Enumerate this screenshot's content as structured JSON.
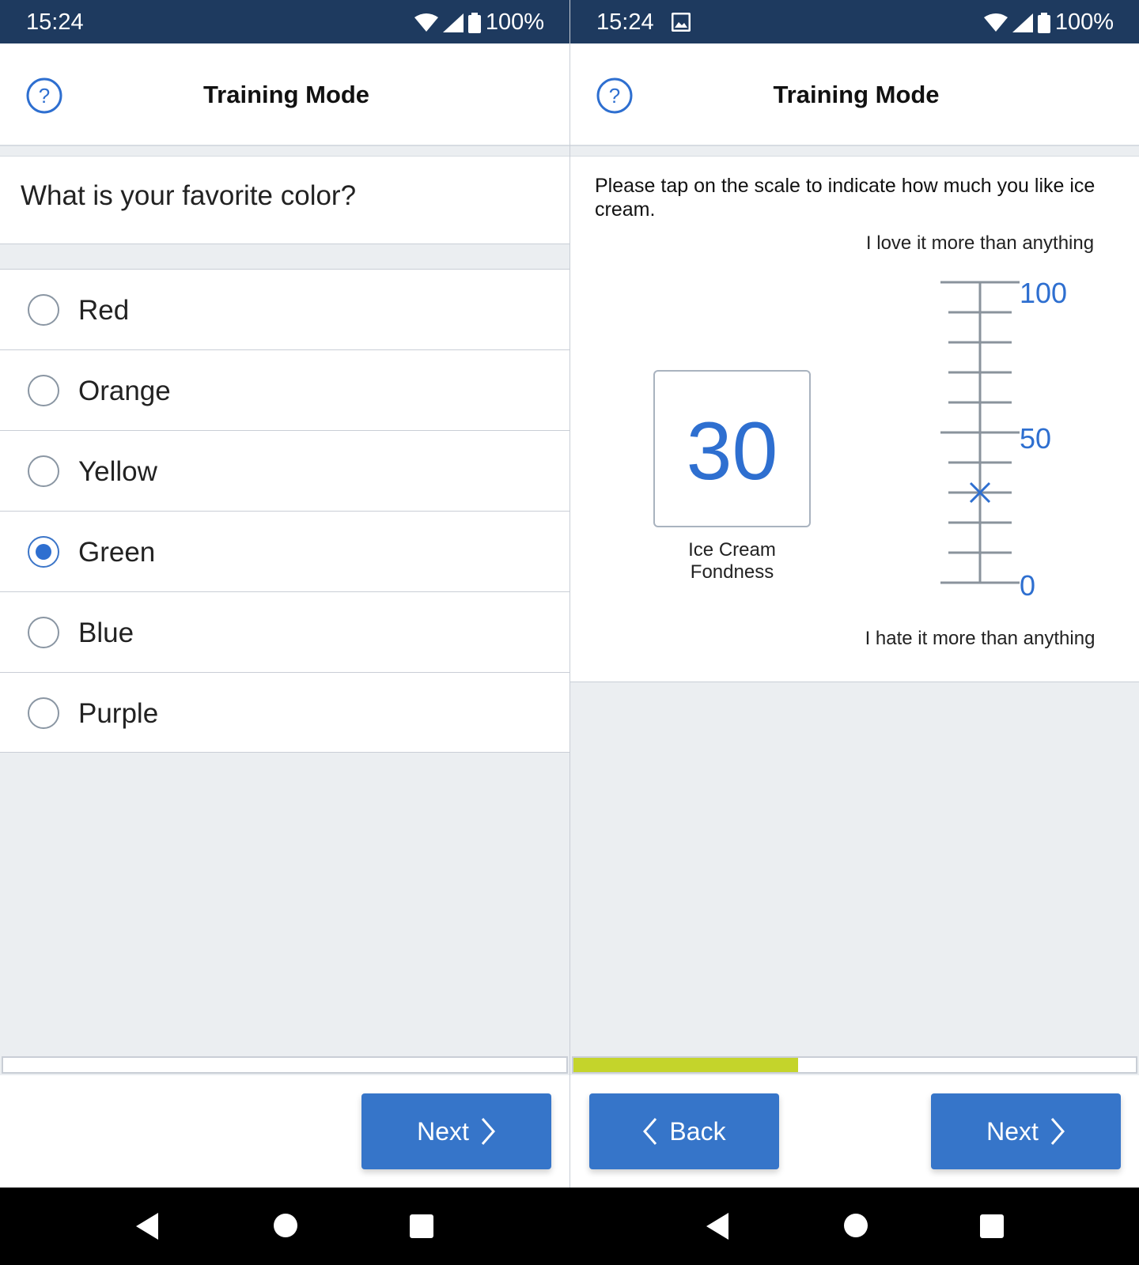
{
  "left_screen": {
    "status_bar": {
      "time": "15:24",
      "battery": "100%"
    },
    "app_bar": {
      "title": "Training Mode",
      "help_icon": "help-circle-icon"
    },
    "question": "What is your favorite color?",
    "options": [
      {
        "label": "Red",
        "selected": false
      },
      {
        "label": "Orange",
        "selected": false
      },
      {
        "label": "Yellow",
        "selected": false
      },
      {
        "label": "Green",
        "selected": true
      },
      {
        "label": "Blue",
        "selected": false
      },
      {
        "label": "Purple",
        "selected": false
      }
    ],
    "progress_fraction": 0,
    "next_label": "Next"
  },
  "right_screen": {
    "status_bar": {
      "time": "15:24",
      "battery": "100%"
    },
    "app_bar": {
      "title": "Training Mode",
      "help_icon": "help-circle-icon"
    },
    "instructions": "Please tap on the scale to indicate how much you like ice cream.",
    "scale": {
      "top_label": "I love it more than anything",
      "bottom_label": "I hate it more than anything",
      "max": "100",
      "mid": "50",
      "min": "0",
      "selected_value": 30
    },
    "value_display": "30",
    "value_label": "Ice Cream Fondness",
    "progress_fraction": 0.4,
    "back_label": "Back",
    "next_label": "Next"
  },
  "colors": {
    "accent": "#3675c9",
    "status_bar": "#1e3a5f",
    "progress": "#c4d42b",
    "background": "#ebeef1"
  }
}
